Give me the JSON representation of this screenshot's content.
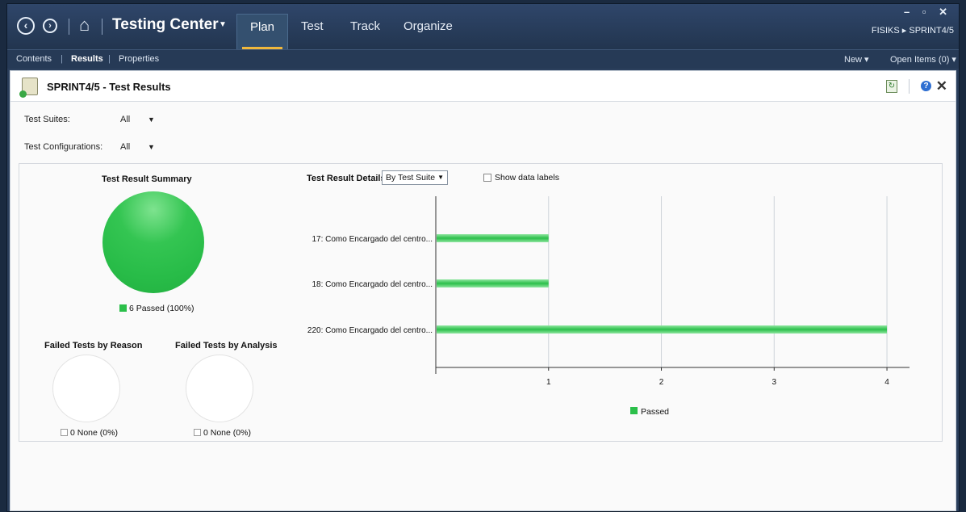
{
  "window": {
    "app_title": "Testing Center",
    "tabs": [
      "Plan",
      "Test",
      "Track",
      "Organize"
    ],
    "active_tab": "Plan",
    "project_path": "FISIKS ▸ SPRINT4/5",
    "controls": "– ▫ ✕"
  },
  "subnav": {
    "items": [
      "Contents",
      "Results",
      "Properties"
    ],
    "new_label": "New ▾",
    "open_items_label": "Open Items (0) ▾"
  },
  "page": {
    "title": "SPRINT4/5 - Test Results"
  },
  "filters": {
    "suites_label": "Test Suites:",
    "suites_value": "All",
    "configs_label": "Test Configurations:",
    "configs_value": "All"
  },
  "summary": {
    "title": "Test Result Summary",
    "legend": "6 Passed (100%)",
    "fail_reason_title": "Failed Tests by Reason",
    "fail_reason_legend": "0 None (0%)",
    "fail_analysis_title": "Failed Tests by Analysis",
    "fail_analysis_legend": "0 None (0%)"
  },
  "details": {
    "title": "Test Result Details",
    "group_by": "By Test Suite",
    "show_labels": "Show data labels"
  },
  "chart_data": [
    {
      "type": "pie",
      "title": "Test Result Summary",
      "slices": [
        {
          "label": "Passed",
          "value": 6,
          "percent": 100,
          "color": "#2bbf4a"
        }
      ]
    },
    {
      "type": "pie",
      "title": "Failed Tests by Reason",
      "slices": [
        {
          "label": "None",
          "value": 0,
          "percent": 0
        }
      ]
    },
    {
      "type": "pie",
      "title": "Failed Tests by Analysis",
      "slices": [
        {
          "label": "None",
          "value": 0,
          "percent": 0
        }
      ]
    },
    {
      "type": "bar",
      "orientation": "horizontal",
      "title": "Test Result Details",
      "categories": [
        "17: Como Encargado del centro...",
        "18: Como Encargado del centro...",
        "220: Como Encargado del centro..."
      ],
      "series": [
        {
          "name": "Passed",
          "values": [
            1,
            1,
            4
          ],
          "color": "#2bbf4a"
        }
      ],
      "xticks": [
        1,
        2,
        3,
        4
      ],
      "xlim": [
        0,
        4.2
      ],
      "grid": true,
      "legend": "bottom"
    }
  ]
}
